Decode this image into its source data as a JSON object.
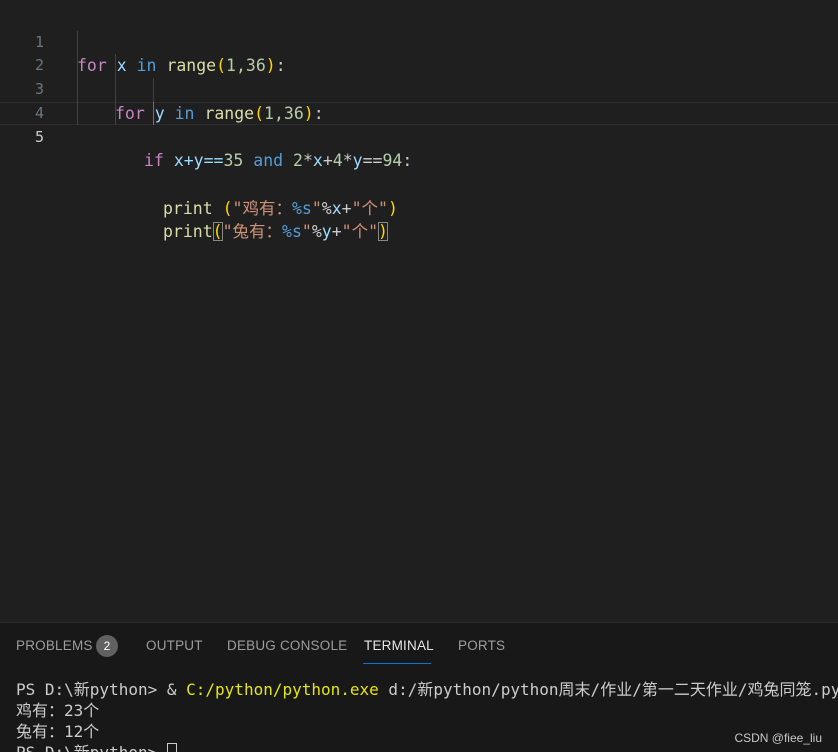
{
  "editor": {
    "line_numbers": [
      "1",
      "2",
      "3",
      "4",
      "5"
    ],
    "tokens": {
      "for": "for",
      "x": "x",
      "in": "in",
      "range": "range",
      "lp": "(",
      "rp": ")",
      "args": "1,36",
      "colon": ":",
      "y": "y",
      "if": "if",
      "xy_eq": "x+y==",
      "n35": "35",
      "and": "and",
      "n2": "2",
      "star": "*",
      "plus": "+",
      "n4": "4",
      "eqeq": "==",
      "n94": "94",
      "print": "print",
      "str_ji_open": "\"鸡有：",
      "str_tu_open": "\"兔有：",
      "fmt_s": "%s",
      "quote": "\"",
      "pct": "%",
      "str_ge": "\"个\""
    }
  },
  "panel": {
    "tabs": [
      {
        "label": "PROBLEMS"
      },
      {
        "label": "OUTPUT"
      },
      {
        "label": "DEBUG CONSOLE"
      },
      {
        "label": "TERMINAL"
      },
      {
        "label": "PORTS"
      }
    ],
    "problems_count": "2",
    "active_tab": "TERMINAL"
  },
  "terminal": {
    "prompt": "PS D:\\新python> & ",
    "exe": "C:/python/python.exe",
    "script": " d:/新python/python周末/作业/第一二天作业/鸡兔同笼.py",
    "output_1": "鸡有：23个",
    "output_2": "兔有：12个",
    "prompt_partial": "PS D:\\新python> "
  },
  "watermark": "CSDN @fiee_liu",
  "colors": {
    "editor_bg": "#1f1f1f",
    "panel_bg": "#181818",
    "accent": "#0078d4"
  }
}
